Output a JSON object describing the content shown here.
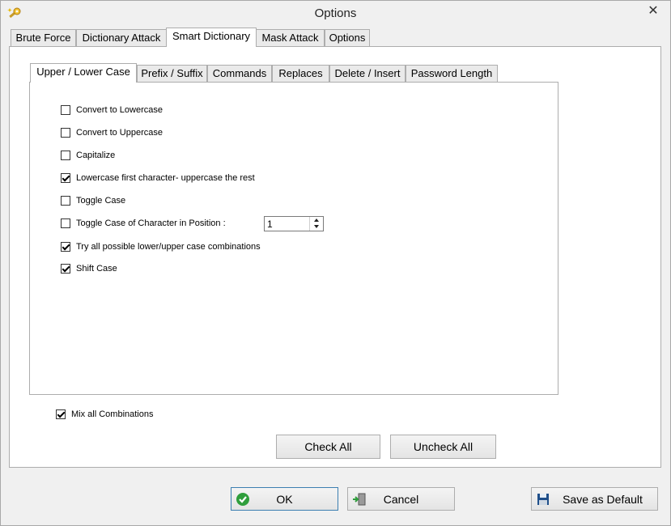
{
  "window": {
    "title": "Options",
    "close_glyph": "✕",
    "icon": "key-wand-icon"
  },
  "main_tabs": [
    {
      "label": "Brute Force",
      "active": false
    },
    {
      "label": "Dictionary Attack",
      "active": false
    },
    {
      "label": "Smart Dictionary",
      "active": true
    },
    {
      "label": "Mask Attack",
      "active": false
    },
    {
      "label": "Options",
      "active": false
    }
  ],
  "sub_tabs": [
    {
      "label": "Upper / Lower Case",
      "active": true
    },
    {
      "label": "Prefix / Suffix",
      "active": false
    },
    {
      "label": "Commands",
      "active": false
    },
    {
      "label": "Replaces",
      "active": false
    },
    {
      "label": "Delete / Insert",
      "active": false
    },
    {
      "label": "Password Length",
      "active": false
    }
  ],
  "options": [
    {
      "label": "Convert to Lowercase",
      "checked": false
    },
    {
      "label": "Convert to Uppercase",
      "checked": false
    },
    {
      "label": "Capitalize",
      "checked": false
    },
    {
      "label": "Lowercase first character- uppercase the rest",
      "checked": true
    },
    {
      "label": "Toggle Case",
      "checked": false
    },
    {
      "label": "Toggle Case of Character in Position :",
      "checked": false
    },
    {
      "label": "Try all possible lower/upper case combinations",
      "checked": true
    },
    {
      "label": "Shift Case",
      "checked": true
    }
  ],
  "position_spinner": {
    "value": "1"
  },
  "mix_all": {
    "label": "Mix all Combinations",
    "checked": true
  },
  "buttons": {
    "check_all": "Check All",
    "uncheck_all": "Uncheck All",
    "ok": "OK",
    "cancel": "Cancel",
    "save_default": "Save as Default"
  },
  "colors": {
    "accent": "#3c7fb1",
    "ok_green": "#2f9e3c",
    "save_blue": "#1f4f8a"
  }
}
